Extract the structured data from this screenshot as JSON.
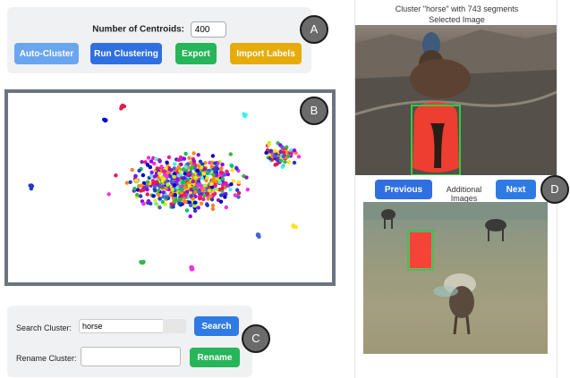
{
  "controls": {
    "centroids_label": "Number of Centroids:",
    "centroids_value": "400",
    "auto_cluster_label": "Auto-Cluster",
    "run_clustering_label": "Run Clustering",
    "export_label": "Export",
    "import_labels_label": "Import Labels"
  },
  "markers": {
    "a": "A",
    "b": "B",
    "c": "C",
    "d": "D"
  },
  "search": {
    "search_cluster_label": "Search Cluster:",
    "search_value": "horse",
    "search_button_label": "Search",
    "rename_cluster_label": "Rename Cluster:",
    "rename_value": "",
    "rename_button_label": "Rename"
  },
  "viewer": {
    "cluster_caption": "Cluster \"horse\" with 743 segments",
    "selected_caption": "Selected Image",
    "previous_label": "Previous",
    "additional_label": "Additional Images",
    "next_label": "Next"
  },
  "colors": {
    "blue_button": "#2f6fe0",
    "light_blue_button": "#6aa6f0",
    "green_button": "#27b559",
    "yellow_button": "#e6ac0c",
    "highlight_box": "#2ecc40",
    "segment_mask": "#ff3b2f"
  }
}
